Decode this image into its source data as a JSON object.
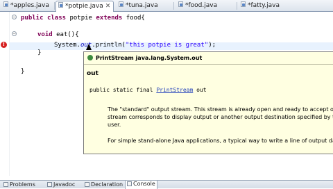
{
  "editor_tabs": [
    {
      "label": "*apples.java",
      "active": false
    },
    {
      "label": "*potpie.java",
      "active": true
    },
    {
      "label": "*tuna.java",
      "active": false
    },
    {
      "label": "*food.java",
      "active": false
    },
    {
      "label": "*fatty.java",
      "active": false
    }
  ],
  "code": {
    "line1_kw1": "public",
    "line1_kw2": "class",
    "line1_name": "potpie",
    "line1_kw3": "extends",
    "line1_rest": "food{",
    "line3_kw": "void",
    "line3_rest": "eat(){",
    "line4_sys": "System.",
    "line4_out": "out",
    "line4_call": ".println(",
    "line4_str": "\"this potpie is great\"",
    "line4_end": ");",
    "line5": "}",
    "line7": "}"
  },
  "popup": {
    "header": "PrintStream java.lang.System.out",
    "title": "out",
    "sig_prefix": "public static final ",
    "sig_link": "PrintStream",
    "sig_suffix": " out",
    "desc_line1": "The \"standard\" output stream. This stream is already open and ready to accept out",
    "desc_line2": "stream corresponds to display output or another output destination specified by th",
    "desc_line3": "user.",
    "desc_line4": "For simple stand-alone Java applications, a typical way to write a line of output dat"
  },
  "bottom_tabs": [
    "Problems",
    "Javadoc",
    "Declaration",
    "Console"
  ],
  "colors": {
    "keyword": "#7f0055",
    "string": "#2a00ff",
    "field": "#0000c0",
    "popup_bg": "#ffffe1",
    "error_marker": "#d62020"
  },
  "icons": [
    "java-file-icon",
    "close-icon",
    "error-marker-icon",
    "fold-icon",
    "field-icon",
    "view-tab-icon"
  ]
}
